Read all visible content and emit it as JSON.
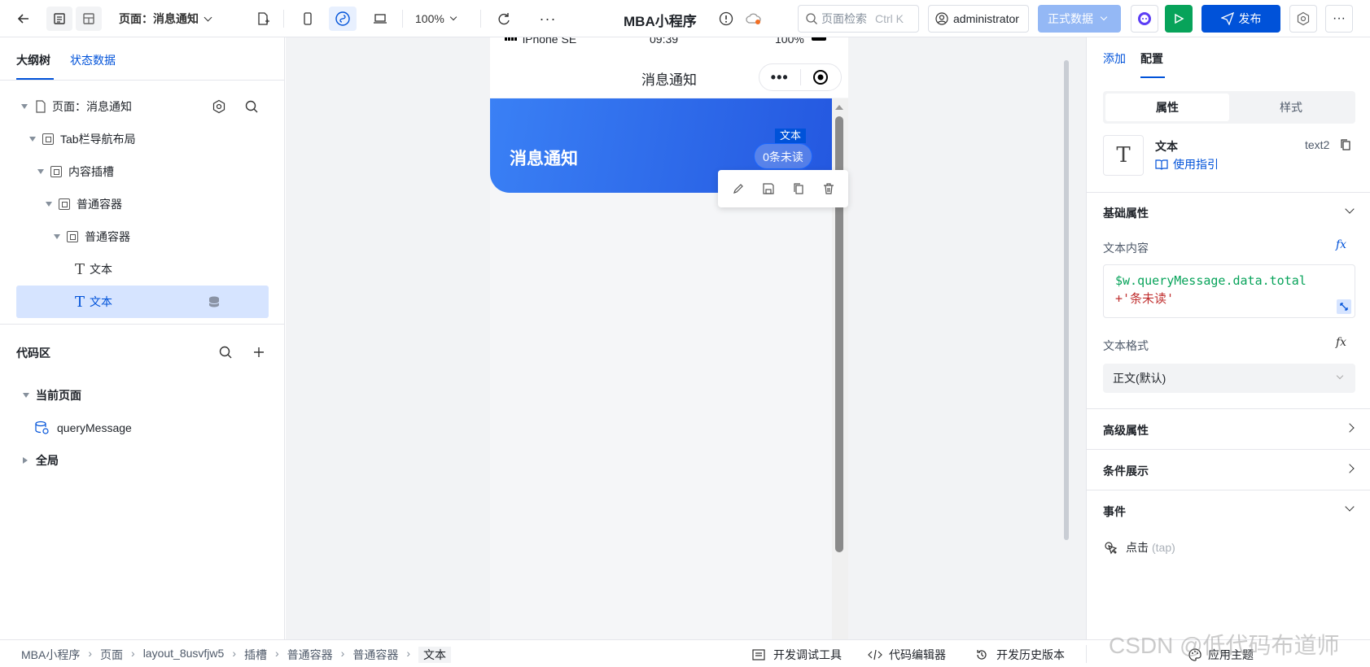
{
  "topbar": {
    "page_selector": "页面：消息通知",
    "zoom": "100%",
    "app_title": "MBA小程序",
    "search_placeholder": "页面检索",
    "search_shortcut": "Ctrl K",
    "user": "administrator",
    "env_select": "正式数据",
    "publish_label": "发布"
  },
  "left": {
    "tabs": [
      "大纲树",
      "状态数据"
    ],
    "tree": [
      {
        "label": "页面：消息通知",
        "icon": "page-icon"
      },
      {
        "label": "Tab栏导航布局",
        "icon": "container-icon"
      },
      {
        "label": "内容插槽",
        "icon": "container-icon"
      },
      {
        "label": "普通容器",
        "icon": "container-icon"
      },
      {
        "label": "普通容器",
        "icon": "container-icon"
      },
      {
        "label": "文本",
        "icon": "text-icon"
      },
      {
        "label": "文本",
        "icon": "text-icon",
        "selected": true
      }
    ],
    "code_area": {
      "title": "代码区",
      "current_page": "当前页面",
      "query": "queryMessage",
      "global": "全局"
    }
  },
  "phone": {
    "status_carrier": "iPhone SE",
    "status_time": "09:39",
    "status_battery": "100%",
    "nav_title": "消息通知",
    "banner_title": "消息通知",
    "badge_text": "0条未读",
    "selection_tag": "文本"
  },
  "right": {
    "tabs": [
      "添加",
      "配置"
    ],
    "segments": [
      "属性",
      "样式"
    ],
    "component": {
      "name": "文本",
      "id": "text2",
      "guide": "使用指引"
    },
    "basic_props_title": "基础属性",
    "text_content_label": "文本内容",
    "expr_var": "$w.queryMessage.data.total",
    "expr_str": "+'条未读'",
    "text_format_label": "文本格式",
    "text_format_value": "正文(默认)",
    "advanced_title": "高级属性",
    "condition_title": "条件展示",
    "events_title": "事件",
    "event_item": "点击",
    "event_code": "(tap)"
  },
  "bottombar": {
    "breadcrumb": [
      "MBA小程序",
      "页面",
      "layout_8usvfjw5",
      "插槽",
      "普通容器",
      "普通容器",
      "文本"
    ],
    "tools": [
      "开发调试工具",
      "代码编辑器",
      "开发历史版本",
      "应用主题"
    ]
  },
  "watermark": "CSDN @低代码布道师",
  "colors": {
    "primary": "#0052d9",
    "banner_start": "#3a80f5",
    "banner_end": "#2458e0",
    "run_green": "#07a35a"
  }
}
